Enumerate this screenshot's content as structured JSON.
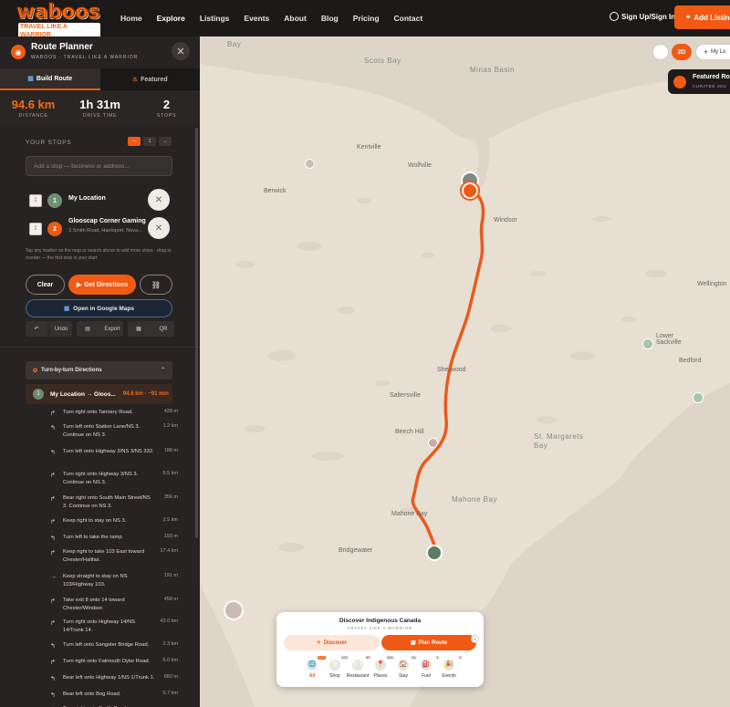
{
  "nav": {
    "logo_text": "waboos",
    "logo_tagline": "TRAVEL LIKE A WARRIOR",
    "links": [
      "Home",
      "Explore",
      "Listings",
      "Events",
      "About",
      "Blog",
      "Pricing",
      "Contact"
    ],
    "active_link": "Explore",
    "signin_label": "Sign Up/Sign In",
    "add_listing_label": "Add Listing"
  },
  "sidebar": {
    "title": "Route Planner",
    "subtitle": "WABOOS · TRAVEL LIKE A WARRIOR",
    "tabs": [
      {
        "label": "Build Route",
        "icon": "map-icon",
        "active": true
      },
      {
        "label": "Featured",
        "icon": "fire-icon",
        "active": false
      }
    ],
    "stats": [
      {
        "value": "94.6 km",
        "label": "DISTANCE"
      },
      {
        "value": "1h 31m",
        "label": "DRIVE TIME"
      },
      {
        "value": "2",
        "label": "STOPS"
      }
    ],
    "your_stops_label": "YOUR STOPS",
    "mini_buttons": [
      "—",
      "1",
      "↔"
    ],
    "add_stop_placeholder": "Add a stop — business or address...",
    "stops": [
      {
        "num": "1",
        "name": "My Location",
        "address": "",
        "color": "#6f8f74"
      },
      {
        "num": "2",
        "name": "Glooscap Corner Gaming",
        "address": "3 Smith Road, Hantsport, Nova...",
        "color": "#f05a14"
      }
    ],
    "hint": "Tap any marker on the map or search above to add more stops · drag to reorder — the first stop is your start",
    "buttons": {
      "clear": "Clear",
      "directions": "Get Directions",
      "google_maps": "Open in Google Maps",
      "undo": "Undo",
      "export": "Export",
      "qr": "QR"
    },
    "directions_header": "Turn-by-turn Directions",
    "leg": {
      "num": "1",
      "title": "My Location → Gloos...",
      "meta": "94.6 km · ~91 min"
    },
    "steps": [
      {
        "text": "Turn right onto Tannery Road.",
        "dist": "428 m",
        "icon": "↱"
      },
      {
        "text": "Turn left onto Station Lane/NS 3. Continue on NS 3.",
        "dist": "1.2 km",
        "icon": "↰"
      },
      {
        "text": "Turn left onto Highway 3/NS 3/NS 332.",
        "dist": "188 m",
        "icon": "↰"
      },
      {
        "text": "Turn right onto Highway 3/NS 3. Continue on NS 3.",
        "dist": "9.5 km",
        "icon": "↱"
      },
      {
        "text": "Bear right onto South Main Street/NS 3. Continue on NS 3.",
        "dist": "356 m",
        "icon": "↱"
      },
      {
        "text": "Keep right to stay on NS 3.",
        "dist": "2.5 km",
        "icon": "↱"
      },
      {
        "text": "Turn left to take the ramp.",
        "dist": "193 m",
        "icon": "↰"
      },
      {
        "text": "Keep right to take 103 East toward Chester/Halifax.",
        "dist": "17.4 km",
        "icon": "↱"
      },
      {
        "text": "Keep straight to stay on NS 103/Highway 103.",
        "dist": "191 m",
        "icon": "→"
      },
      {
        "text": "Take exit 8 onto 14 toward Chester/Windsor.",
        "dist": "458 m",
        "icon": "↱"
      },
      {
        "text": "Turn right onto Highway 14/NS 14/Trunk 14.",
        "dist": "43.0 km",
        "icon": "↱"
      },
      {
        "text": "Turn left onto Sangster Bridge Road.",
        "dist": "2.3 km",
        "icon": "↰"
      },
      {
        "text": "Turn right onto Falmouth Dyke Road.",
        "dist": "6.0 km",
        "icon": "↱"
      },
      {
        "text": "Bear left onto Highway 1/NS 1/Trunk 1.",
        "dist": "682 m",
        "icon": "↰"
      },
      {
        "text": "Bear left onto Bog Road.",
        "dist": "5.7 km",
        "icon": "↰"
      },
      {
        "text": "Turn right onto Smith Road.",
        "dist": "",
        "icon": "↱"
      }
    ]
  },
  "map": {
    "controls": {
      "mode_2d": "2D",
      "locate": "My Lo"
    },
    "featured_card": {
      "title": "Featured Ro",
      "subtitle": "CURATED JOU"
    },
    "water_labels": [
      "Bay",
      "Scots Bay",
      "Minas Basin",
      "St. Margarets Bay",
      "Mahone Bay"
    ],
    "place_labels": [
      "Kentville",
      "Wolfville",
      "Berwick",
      "Windsor",
      "Lower Sackville",
      "Bedford",
      "Wellington",
      "Sherwood",
      "Beech Hill",
      "Mahone Bay",
      "Bridgewater",
      "Saltersville"
    ]
  },
  "discover": {
    "title": "Discover Indigenous Canada",
    "subtitle": "TRAVEL LIKE A WARRIOR",
    "discover_label": "Discover",
    "plan_label": "Plan Route",
    "plan_badge": "2",
    "categories": [
      {
        "label": "All",
        "count": "443",
        "icon": "🌐",
        "active": true
      },
      {
        "label": "Shop",
        "count": "123",
        "icon": "🛍",
        "active": false
      },
      {
        "label": "Restaurant",
        "count": "87",
        "icon": "🍽",
        "active": false
      },
      {
        "label": "Places",
        "count": "133",
        "icon": "📍",
        "active": false
      },
      {
        "label": "Stay",
        "count": "24",
        "icon": "🏠",
        "active": false
      },
      {
        "label": "Fuel",
        "count": "1",
        "icon": "⛽",
        "active": false
      },
      {
        "label": "Events",
        "count": "1",
        "icon": "🎉",
        "active": false
      }
    ]
  },
  "colors": {
    "accent": "#f05a14",
    "dark": "#262322",
    "route": "#ea5a1e",
    "water": "#ddd6c8"
  }
}
